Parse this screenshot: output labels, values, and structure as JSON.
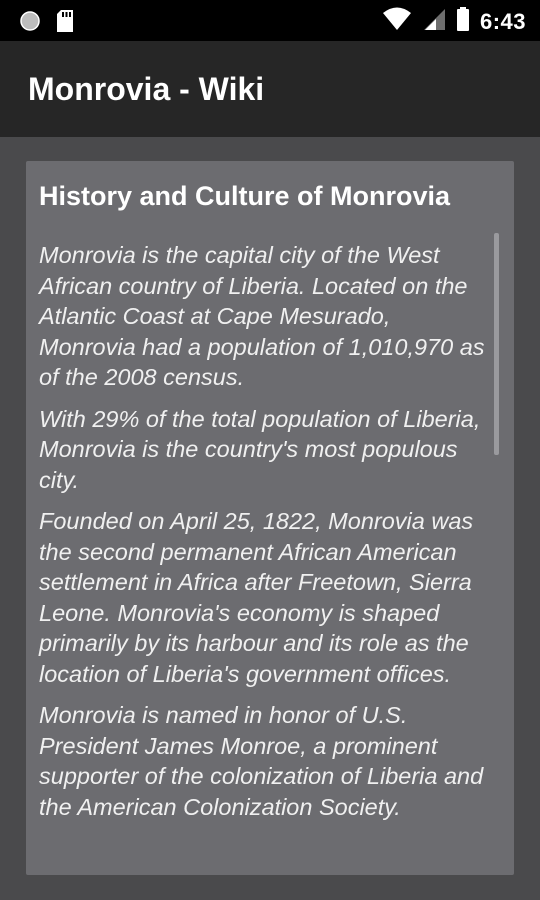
{
  "status_bar": {
    "time": "6:43",
    "icons": [
      "circle-notification-icon",
      "sd-card-icon",
      "wifi-icon",
      "cell-signal-icon",
      "battery-icon"
    ]
  },
  "app_bar": {
    "title": "Monrovia - Wiki"
  },
  "article": {
    "title": "History and Culture of Monrovia",
    "paragraphs": [
      "Monrovia is the capital city of the West African country of Liberia. Located on the Atlantic Coast at Cape Mesurado, Monrovia had a population of 1,010,970 as of the 2008 census.",
      "With 29% of the total population of Liberia, Monrovia is the country's most populous city.",
      "Founded on April 25, 1822, Monrovia was the second permanent African American settlement in Africa after Freetown, Sierra Leone. Monrovia's economy is shaped primarily by its harbour and its role as the location of Liberia's government offices.",
      "Monrovia is named in honor of U.S. President James Monroe, a prominent supporter of the colonization of Liberia and the American Colonization Society."
    ]
  },
  "colors": {
    "status_bar": "#000000",
    "app_bar": "#262626",
    "background": "#4a4a4c",
    "card": "#6c6c70",
    "text": "#ffffff"
  }
}
